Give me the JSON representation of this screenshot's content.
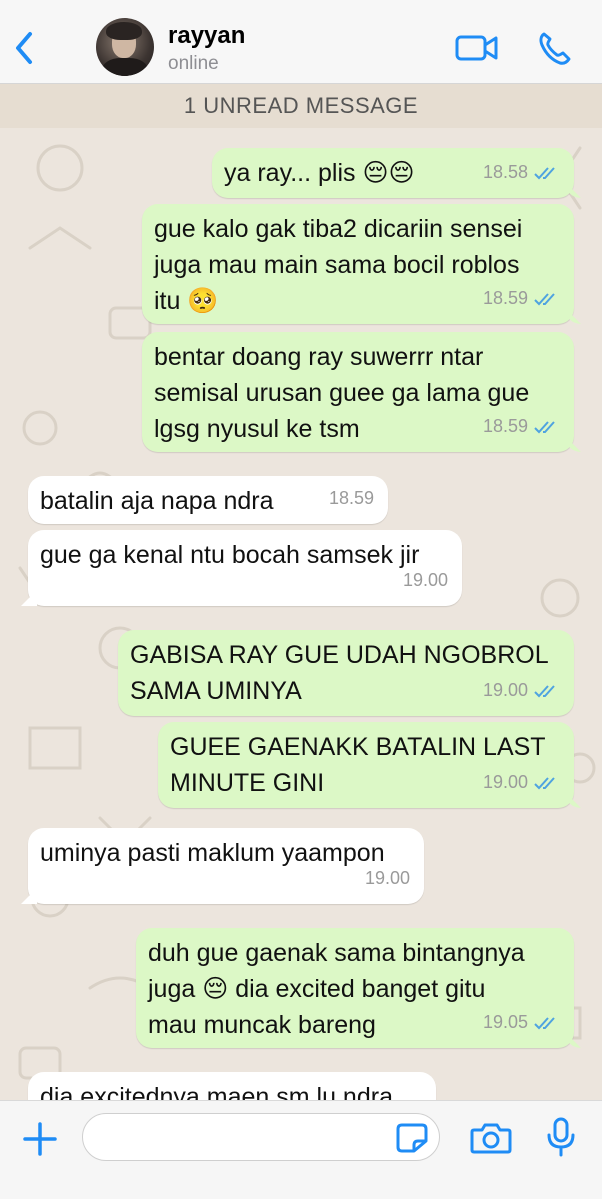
{
  "header": {
    "back_icon": "chevron-left-icon",
    "contact_name": "rayyan",
    "status": "online",
    "video_icon": "video-camera-icon",
    "call_icon": "phone-icon",
    "accent_color": "#1f8cf5"
  },
  "unread_banner": "1 UNREAD MESSAGE",
  "messages": [
    {
      "direction": "out",
      "text": "ya ray... plis 😔😔",
      "time": "18.58",
      "read": true
    },
    {
      "direction": "out",
      "text": "gue kalo gak tiba2 dicariin sensei\njuga mau main sama bocil roblos\nitu 🥺",
      "time": "18.59",
      "read": true
    },
    {
      "direction": "out",
      "text": "bentar doang ray suwerrr ntar\nsemisal urusan guee ga lama gue\nlgsg nyusul ke tsm",
      "time": "18.59",
      "read": true
    },
    {
      "direction": "in",
      "text": "batalin aja napa ndra",
      "time": "18.59"
    },
    {
      "direction": "in",
      "text": "gue ga kenal ntu bocah samsek jir",
      "time": "19.00"
    },
    {
      "direction": "out",
      "text": "GABISA RAY GUE UDAH NGOBROL\nSAMA UMINYA",
      "time": "19.00",
      "read": true
    },
    {
      "direction": "out",
      "text": "GUEE GAENAKK BATALIN LAST\nMINUTE GINI",
      "time": "19.00",
      "read": true
    },
    {
      "direction": "in",
      "text": "uminya pasti maklum yaampon",
      "time": "19.00"
    },
    {
      "direction": "out",
      "text": "duh gue gaenak sama bintangnya\njuga 😔 dia excited banget gitu\nmau muncak bareng",
      "time": "19.05",
      "read": true
    },
    {
      "direction": "in",
      "text": "dia excitednya maen sm lu ndra",
      "time": ""
    }
  ],
  "colors": {
    "outgoing_bubble": "#dcf8c6",
    "incoming_bubble": "#ffffff",
    "read_ticks": "#4fa3e0",
    "chat_background": "#ece5dd"
  },
  "footer": {
    "plus_icon": "plus-icon",
    "input_placeholder": "",
    "sticker_icon": "sticker-icon",
    "camera_icon": "camera-icon",
    "mic_icon": "microphone-icon"
  }
}
